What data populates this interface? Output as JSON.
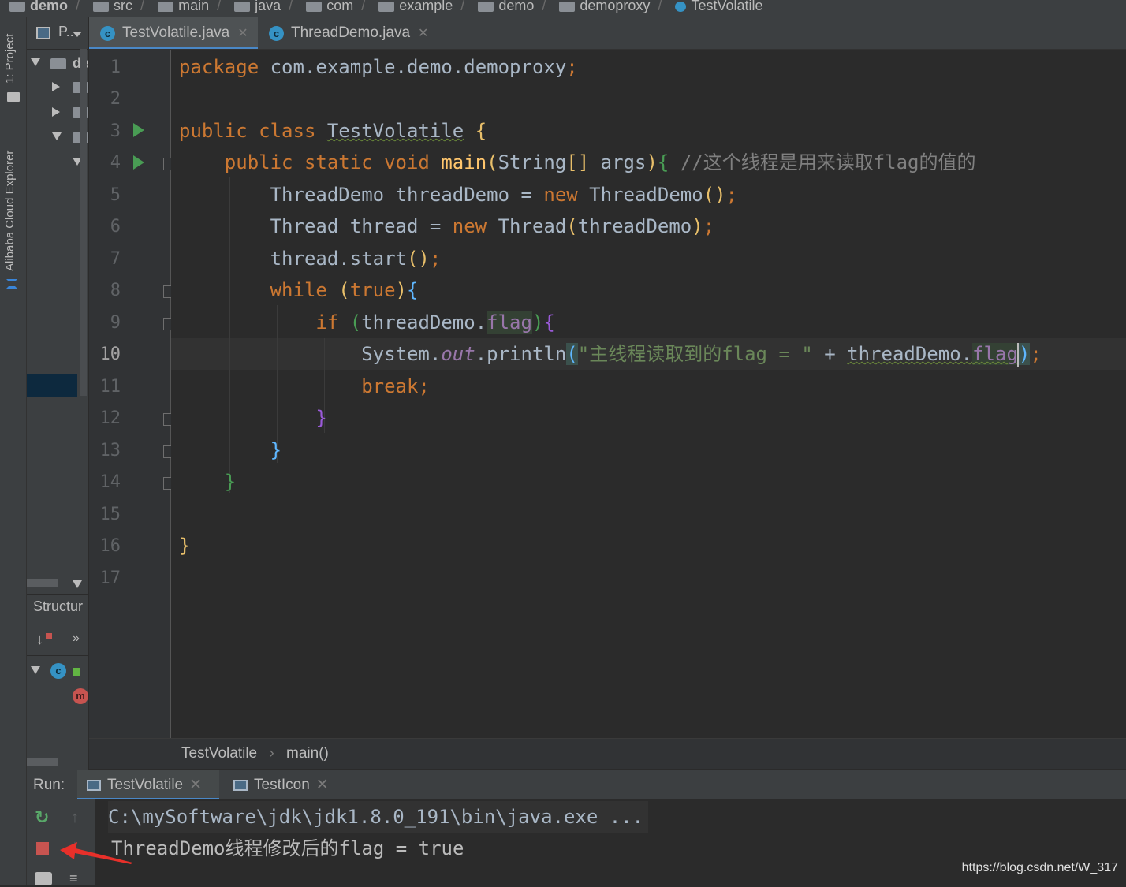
{
  "breadcrumbs": [
    "demo",
    "src",
    "main",
    "java",
    "com",
    "example",
    "demo",
    "demoproxy",
    "TestVolatile"
  ],
  "left_stripe": {
    "project_label": "1: Project",
    "cloud_label": "Alibaba Cloud Explorer"
  },
  "project_panel": {
    "title": "P..",
    "root_label": "de"
  },
  "tabs": [
    {
      "label": "TestVolatile.java",
      "icon": "class-icon",
      "active": true
    },
    {
      "label": "ThreadDemo.java",
      "icon": "class-icon",
      "active": false
    }
  ],
  "editor": {
    "current_line": 10,
    "lines": [
      {
        "n": "1",
        "text": "package com.example.demo.demoproxy;"
      },
      {
        "n": "2",
        "text": ""
      },
      {
        "n": "3",
        "text": "public class TestVolatile {"
      },
      {
        "n": "4",
        "text": "    public static void main(String[] args){ //这个线程是用来读取flag的值的"
      },
      {
        "n": "5",
        "text": "        ThreadDemo threadDemo = new ThreadDemo();"
      },
      {
        "n": "6",
        "text": "        Thread thread = new Thread(threadDemo);"
      },
      {
        "n": "7",
        "text": "        thread.start();"
      },
      {
        "n": "8",
        "text": "        while (true){"
      },
      {
        "n": "9",
        "text": "            if (threadDemo.flag){"
      },
      {
        "n": "10",
        "text": "                System.out.println(\"主线程读取到的flag = \" + threadDemo.flag);"
      },
      {
        "n": "11",
        "text": "                break;"
      },
      {
        "n": "12",
        "text": "            }"
      },
      {
        "n": "13",
        "text": "        }"
      },
      {
        "n": "14",
        "text": "    }"
      },
      {
        "n": "15",
        "text": ""
      },
      {
        "n": "16",
        "text": "}"
      },
      {
        "n": "17",
        "text": ""
      }
    ]
  },
  "editor_breadcrumb": {
    "class_name": "TestVolatile",
    "method": "main()"
  },
  "structure_panel": {
    "title": "Structur"
  },
  "run_panel": {
    "label": "Run:",
    "tabs": [
      {
        "label": "TestVolatile",
        "active": true
      },
      {
        "label": "TestIcon",
        "active": false
      }
    ],
    "console_lines": [
      "C:\\mySoftware\\jdk\\jdk1.8.0_191\\bin\\java.exe ...",
      "ThreadDemo线程修改后的flag = true"
    ]
  },
  "watermark": "https://blog.csdn.net/W_317",
  "colors": {
    "background": "#2b2b2b",
    "keyword": "#cc7832",
    "string": "#6a8759",
    "field": "#9876aa",
    "accent": "#4a88c7",
    "stop": "#c75450"
  }
}
